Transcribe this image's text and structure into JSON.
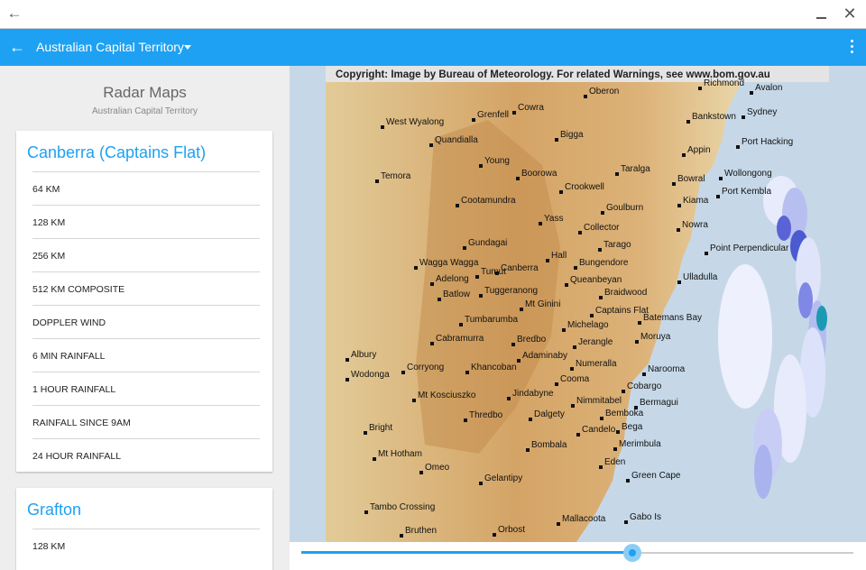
{
  "titlebar": {
    "back_icon": "arrow-left-icon",
    "minimize_icon": "minimize-icon",
    "close_icon": "close-icon"
  },
  "appbar": {
    "title": "Australian Capital Territory",
    "back_icon": "arrow-left-icon",
    "menu_icon": "more-vert-icon",
    "color": "#1ea1f2"
  },
  "panel": {
    "title": "Radar Maps",
    "subtitle": "Australian Capital Territory"
  },
  "cards": [
    {
      "title": "Canberra (Captains Flat)",
      "items": [
        "64 KM",
        "128 KM",
        "256 KM",
        "512 KM COMPOSITE",
        "DOPPLER WIND",
        "6 MIN RAINFALL",
        "1 HOUR RAINFALL",
        "RAINFALL SINCE 9AM",
        "24 HOUR RAINFALL"
      ]
    },
    {
      "title": "Grafton",
      "items": [
        "128 KM"
      ]
    }
  ],
  "map": {
    "copyright": "Copyright: Image by Bureau of Meteorology. For related Warnings, see www.bom.gov.au",
    "places": [
      {
        "name": "Oberon"
      },
      {
        "name": "Richmond"
      },
      {
        "name": "Avalon"
      },
      {
        "name": "Cowra"
      },
      {
        "name": "Grenfell"
      },
      {
        "name": "West Wyalong"
      },
      {
        "name": "Bankstown"
      },
      {
        "name": "Sydney"
      },
      {
        "name": "Quandialla"
      },
      {
        "name": "Bigga"
      },
      {
        "name": "Port Hacking"
      },
      {
        "name": "Appin"
      },
      {
        "name": "Young"
      },
      {
        "name": "Taralga"
      },
      {
        "name": "Boorowa"
      },
      {
        "name": "Temora"
      },
      {
        "name": "Bowral"
      },
      {
        "name": "Wollongong"
      },
      {
        "name": "Crookwell"
      },
      {
        "name": "Port Kembla"
      },
      {
        "name": "Kiama"
      },
      {
        "name": "Cootamundra"
      },
      {
        "name": "Goulburn"
      },
      {
        "name": "Yass"
      },
      {
        "name": "Nowra"
      },
      {
        "name": "Collector"
      },
      {
        "name": "Gundagai"
      },
      {
        "name": "Tarago"
      },
      {
        "name": "Point Perpendicular"
      },
      {
        "name": "Hall"
      },
      {
        "name": "Wagga Wagga"
      },
      {
        "name": "Bungendore"
      },
      {
        "name": "Canberra"
      },
      {
        "name": "Tumut"
      },
      {
        "name": "Adelong"
      },
      {
        "name": "Queanbeyan"
      },
      {
        "name": "Ulladulla"
      },
      {
        "name": "Tuggeranong"
      },
      {
        "name": "Batlow"
      },
      {
        "name": "Braidwood"
      },
      {
        "name": "Mt Ginini"
      },
      {
        "name": "Captains Flat"
      },
      {
        "name": "Tumbarumba"
      },
      {
        "name": "Batemans Bay"
      },
      {
        "name": "Michelago"
      },
      {
        "name": "Cabramurra"
      },
      {
        "name": "Bredbo"
      },
      {
        "name": "Jerangle"
      },
      {
        "name": "Moruya"
      },
      {
        "name": "Albury"
      },
      {
        "name": "Adaminaby"
      },
      {
        "name": "Corryong"
      },
      {
        "name": "Khancoban"
      },
      {
        "name": "Numeralla"
      },
      {
        "name": "Wodonga"
      },
      {
        "name": "Narooma"
      },
      {
        "name": "Cooma"
      },
      {
        "name": "Cobargo"
      },
      {
        "name": "Mt Kosciuszko"
      },
      {
        "name": "Jindabyne"
      },
      {
        "name": "Bermagui"
      },
      {
        "name": "Nimmitabel"
      },
      {
        "name": "Thredbo"
      },
      {
        "name": "Dalgety"
      },
      {
        "name": "Bemboka"
      },
      {
        "name": "Bright"
      },
      {
        "name": "Candelo"
      },
      {
        "name": "Bega"
      },
      {
        "name": "Bombala"
      },
      {
        "name": "Merimbula"
      },
      {
        "name": "Mt Hotham"
      },
      {
        "name": "Omeo"
      },
      {
        "name": "Eden"
      },
      {
        "name": "Green Cape"
      },
      {
        "name": "Gelantipy"
      },
      {
        "name": "Tambo Crossing"
      },
      {
        "name": "Mallacoota"
      },
      {
        "name": "Gabo Is"
      },
      {
        "name": "Bruthen"
      },
      {
        "name": "Orbost"
      }
    ]
  },
  "slider": {
    "value": 0.6
  }
}
